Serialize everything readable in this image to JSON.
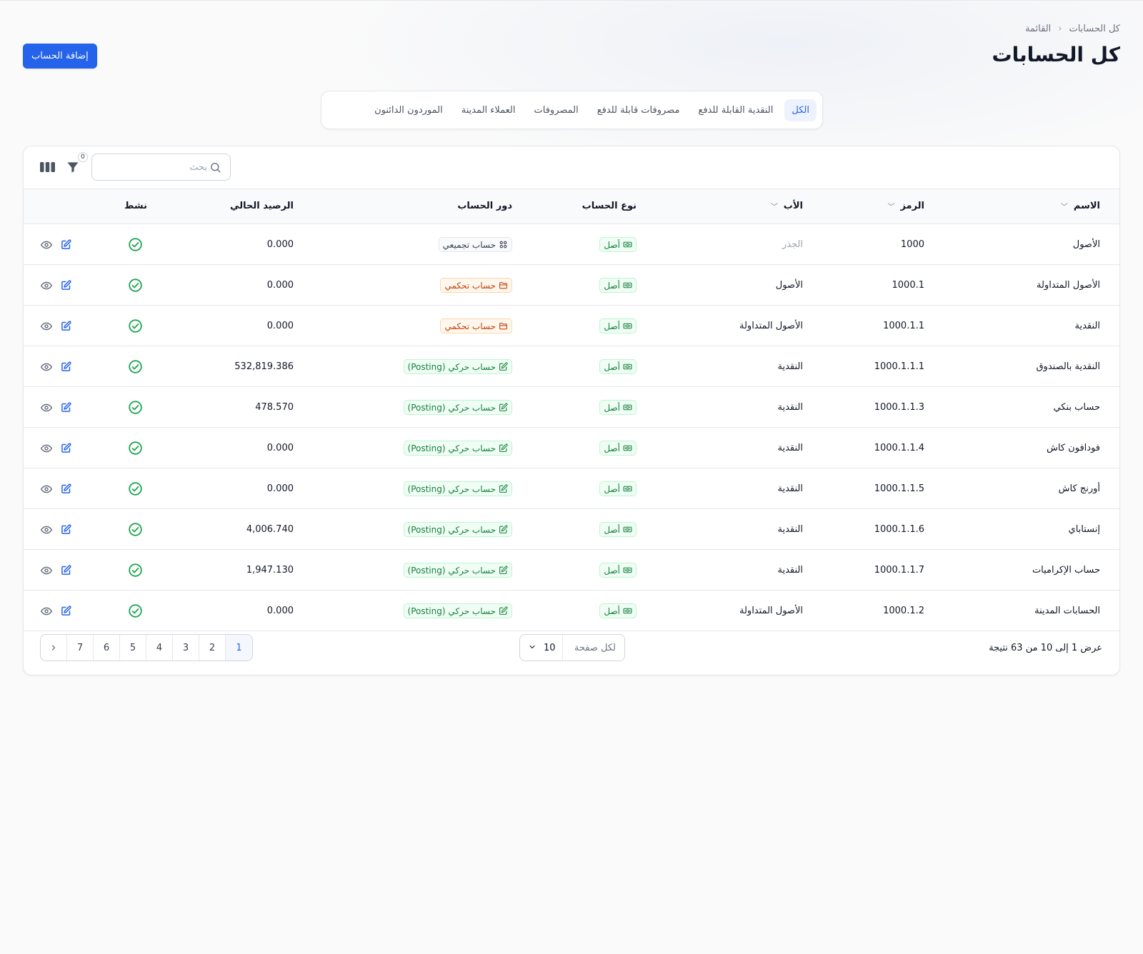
{
  "breadcrumb": {
    "root": "كل الحسابات",
    "current": "القائمة"
  },
  "page_title": "كل الحسابات",
  "add_button_label": "إضافة الحساب",
  "tabs": [
    {
      "label": "الكل",
      "active": true
    },
    {
      "label": "النقدية القابلة للدفع",
      "active": false
    },
    {
      "label": "مصروفات قابلة للدفع",
      "active": false
    },
    {
      "label": "المصروفات",
      "active": false
    },
    {
      "label": "العملاء المدينة",
      "active": false
    },
    {
      "label": "الموردون الدائنون",
      "active": false
    }
  ],
  "toolbar": {
    "search_placeholder": "بحث",
    "search_value": "",
    "filter_count": "0"
  },
  "table": {
    "columns": {
      "name": "الاسم",
      "code": "الرمز",
      "parent": "الأب",
      "type": "نوع الحساب",
      "role": "دور الحساب",
      "balance": "الرصيد الحالي",
      "active": "نشط"
    },
    "rows": [
      {
        "name": "الأصول",
        "code": "1000",
        "parent": "الجذر",
        "parent_muted": true,
        "type": "أصل",
        "role": "حساب تجميعي",
        "role_kind": "gray",
        "balance": "0.000",
        "active": true
      },
      {
        "name": "الأصول المتداولة",
        "code": "1000.1",
        "parent": "الأصول",
        "parent_muted": false,
        "type": "أصل",
        "role": "حساب تحكمي",
        "role_kind": "orange",
        "balance": "0.000",
        "active": true
      },
      {
        "name": "النقدية",
        "code": "1000.1.1",
        "parent": "الأصول المتداولة",
        "parent_muted": false,
        "type": "أصل",
        "role": "حساب تحكمي",
        "role_kind": "orange",
        "balance": "0.000",
        "active": true
      },
      {
        "name": "النقدية بالصندوق",
        "code": "1000.1.1.1",
        "parent": "النقدية",
        "parent_muted": false,
        "type": "أصل",
        "role": "حساب حركي (Posting)",
        "role_kind": "green",
        "balance": "532,819.386",
        "active": true
      },
      {
        "name": "حساب بنكي",
        "code": "1000.1.1.3",
        "parent": "النقدية",
        "parent_muted": false,
        "type": "أصل",
        "role": "حساب حركي (Posting)",
        "role_kind": "green",
        "balance": "478.570",
        "active": true
      },
      {
        "name": "فودافون كاش",
        "code": "1000.1.1.4",
        "parent": "النقدية",
        "parent_muted": false,
        "type": "أصل",
        "role": "حساب حركي (Posting)",
        "role_kind": "green",
        "balance": "0.000",
        "active": true
      },
      {
        "name": "أورنج كاش",
        "code": "1000.1.1.5",
        "parent": "النقدية",
        "parent_muted": false,
        "type": "أصل",
        "role": "حساب حركي (Posting)",
        "role_kind": "green",
        "balance": "0.000",
        "active": true
      },
      {
        "name": "إنستاباي",
        "code": "1000.1.1.6",
        "parent": "النقدية",
        "parent_muted": false,
        "type": "أصل",
        "role": "حساب حركي (Posting)",
        "role_kind": "green",
        "balance": "4,006.740",
        "active": true
      },
      {
        "name": "حساب الإكراميات",
        "code": "1000.1.1.7",
        "parent": "النقدية",
        "parent_muted": false,
        "type": "أصل",
        "role": "حساب حركي (Posting)",
        "role_kind": "green",
        "balance": "1,947.130",
        "active": true
      },
      {
        "name": "الحسابات المدينة",
        "code": "1000.1.2",
        "parent": "الأصول المتداولة",
        "parent_muted": false,
        "type": "أصل",
        "role": "حساب حركي (Posting)",
        "role_kind": "green",
        "balance": "0.000",
        "active": true
      }
    ]
  },
  "footer": {
    "results_text": "عرض 1 إلى 10 من 63 نتيجة",
    "per_page_label": "لكل صفحة",
    "per_page_value": "10",
    "pages": [
      "1",
      "2",
      "3",
      "4",
      "5",
      "6",
      "7"
    ],
    "current_page": "1"
  },
  "colors": {
    "accent": "#2563eb",
    "success": "#16a34a",
    "warning": "#c2410c",
    "border": "#e5e7eb"
  },
  "icons": {
    "breadcrumb_separator": "chevron-left-icon",
    "search": "search-icon",
    "filter": "funnel-icon",
    "columns": "columns-icon",
    "sort": "chevron-down-icon",
    "type_badge": "banknote-icon",
    "role_aggregate": "grid-icon",
    "role_control": "folder-open-icon",
    "role_posting": "pencil-square-icon",
    "active": "check-circle-icon",
    "view": "eye-icon",
    "edit": "edit-icon",
    "next_page": "chevron-right-icon"
  }
}
